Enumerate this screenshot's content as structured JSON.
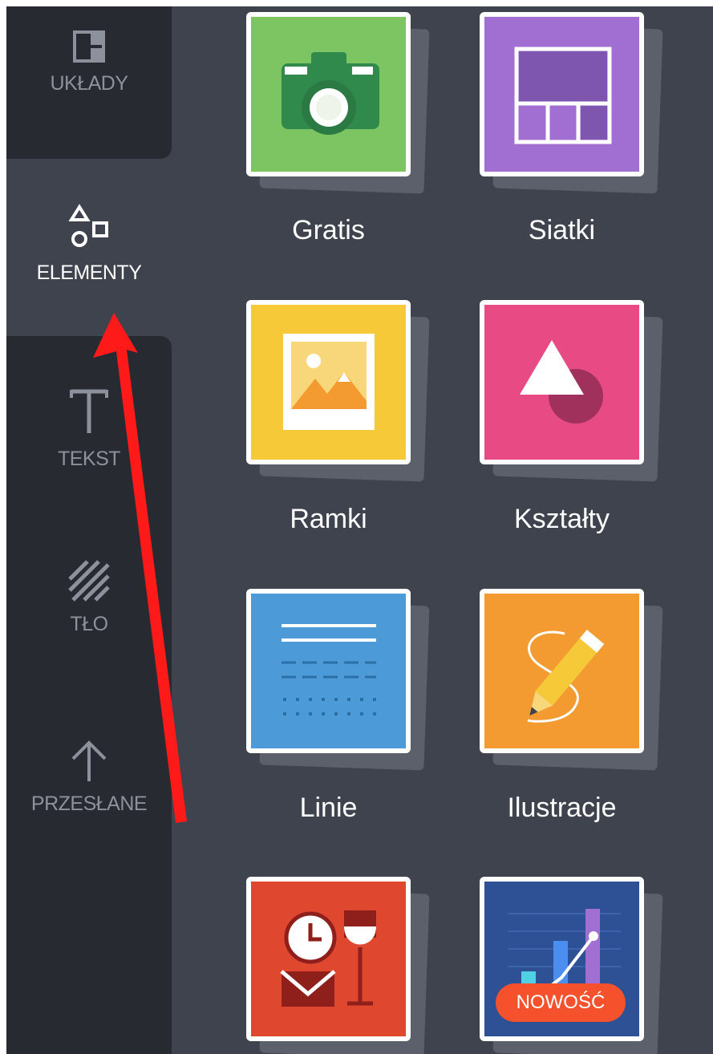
{
  "sidebar": {
    "items": [
      {
        "label": "UKŁADY",
        "icon": "layout-icon",
        "active": false
      },
      {
        "label": "ELEMENTY",
        "icon": "shapes-icon",
        "active": true
      },
      {
        "label": "TEKST",
        "icon": "text-icon",
        "active": false
      },
      {
        "label": "TŁO",
        "icon": "background-icon",
        "active": false
      },
      {
        "label": "PRZESŁANE",
        "icon": "upload-icon",
        "active": false
      }
    ]
  },
  "tiles": [
    {
      "label": "Gratis",
      "color": "#7dc562",
      "icon": "camera-icon"
    },
    {
      "label": "Siatki",
      "color": "#a06fd1",
      "icon": "grid-icon"
    },
    {
      "label": "Ramki",
      "color": "#f5c937",
      "icon": "frame-icon"
    },
    {
      "label": "Kształty",
      "color": "#e84b83",
      "icon": "triangle-circle-icon"
    },
    {
      "label": "Linie",
      "color": "#4c9ad7",
      "icon": "lines-icon"
    },
    {
      "label": "Ilustracje",
      "color": "#f39a31",
      "icon": "pencil-icon"
    },
    {
      "label": "",
      "color": "#e0472f",
      "icon": "clock-wine-icon"
    },
    {
      "label": "",
      "color": "#2e5195",
      "icon": "chart-icon",
      "badge": "NOWOŚĆ"
    }
  ],
  "colors": {
    "sidebar_dark": "#272a31",
    "panel": "#3f434d",
    "arrow": "#ff1a1a"
  }
}
